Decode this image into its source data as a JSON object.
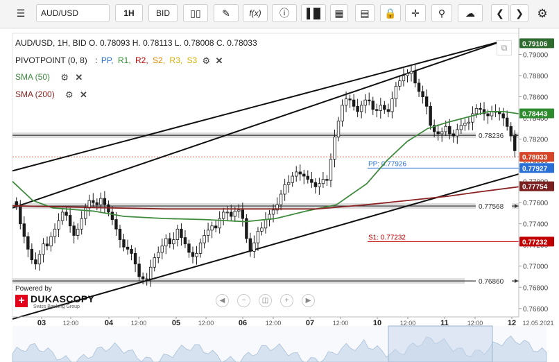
{
  "toolbar": {
    "menu_icon": "hamburger-icon",
    "symbol": "AUD/USD",
    "interval": "1H",
    "side": "BID",
    "icons": [
      "candles-icon",
      "pencil-icon",
      "function-icon",
      "info-icon",
      "bar-chart-icon",
      "calendar-icon",
      "notes-icon",
      "lock-icon",
      "crosshair-icon",
      "zoom-icon",
      "cloud-upload-icon",
      "chevron-left-icon",
      "chevron-right-icon",
      "gear-icon"
    ],
    "fx_label": "f(x)"
  },
  "legend": {
    "ohlc": "AUD/USD, 1H, BID   O. 0.78093 H. 0.78113 L. 0.78008 C. 0.78033",
    "pivot_label": "PIVOTPOINT (0, 8)",
    "pivot_sep": ":",
    "pivot_items": [
      {
        "text": "PP,",
        "color": "#2a6fd6"
      },
      {
        "text": "R1,",
        "color": "#2e8b2e"
      },
      {
        "text": "R2,",
        "color": "#c00000"
      },
      {
        "text": "S2,",
        "color": "#e08a00"
      },
      {
        "text": "R3,",
        "color": "#d4b000"
      },
      {
        "text": "S3",
        "color": "#d4b000"
      }
    ],
    "sma50": "SMA (50)",
    "sma200": "SMA (200)"
  },
  "branding": {
    "powered": "Powered by",
    "name": "DUKASCOPY",
    "tagline": "Swiss Banking Group"
  },
  "chart_data": {
    "type": "candlestick",
    "symbol": "AUD/USD",
    "timeframe": "1H",
    "y_ticks": [
      "0.79000",
      "0.78800",
      "0.78600",
      "0.78400",
      "0.78200",
      "0.78000",
      "0.77800",
      "0.77600",
      "0.77400",
      "0.77200",
      "0.77000",
      "0.76800",
      "0.76600"
    ],
    "ylim": [
      0.7652,
      0.792
    ],
    "x_labels": [
      "03",
      "12:00",
      "04",
      "12:00",
      "05",
      "12:00",
      "06",
      "12:00",
      "07",
      "12:00",
      "10",
      "12:00",
      "11",
      "12:00",
      "12",
      "12.05.2021"
    ],
    "price_badges": [
      {
        "label": "0.79106",
        "value": 0.79106,
        "color": "#2e6b2e"
      },
      {
        "label": "0.78443",
        "value": 0.78443,
        "color": "#2e8b2e"
      },
      {
        "label": "0.78033",
        "value": 0.78033,
        "color": "#d64527"
      },
      {
        "label": "0.77927",
        "value": 0.77927,
        "color": "#2a6fd6"
      },
      {
        "label": "0.77754",
        "value": 0.77754,
        "color": "#7a1f1f"
      },
      {
        "label": "0.77232",
        "value": 0.77232,
        "color": "#c00000"
      }
    ],
    "levels": [
      {
        "label": "0.78236",
        "value": 0.78236
      },
      {
        "label": "0.77568",
        "value": 0.77568
      },
      {
        "label": "0.76860",
        "value": 0.7686
      }
    ],
    "pivot_lines": [
      {
        "label": "PP: 0.77926",
        "value": 0.77926,
        "color": "#2a6fd6"
      },
      {
        "label": "S1: 0.77232",
        "value": 0.77232,
        "color": "#c00000"
      }
    ],
    "close": 0.78033,
    "series": [
      {
        "name": "AUD/USD",
        "close": [
          0.7757,
          0.774,
          0.7728,
          0.7716,
          0.7706,
          0.7702,
          0.7711,
          0.7721,
          0.7719,
          0.7728,
          0.7735,
          0.7743,
          0.7751,
          0.7748,
          0.7738,
          0.7729,
          0.7735,
          0.7745,
          0.7755,
          0.7762,
          0.776,
          0.7758,
          0.7764,
          0.7758,
          0.7751,
          0.7744,
          0.7735,
          0.7725,
          0.7718,
          0.7716,
          0.7712,
          0.7702,
          0.769,
          0.7688,
          0.7688,
          0.7699,
          0.7708,
          0.7713,
          0.7719,
          0.7726,
          0.7721,
          0.7725,
          0.7735,
          0.7727,
          0.7721,
          0.7713,
          0.7709,
          0.7712,
          0.7722,
          0.7729,
          0.7734,
          0.7738,
          0.7736,
          0.7745,
          0.7751,
          0.7751,
          0.7747,
          0.7752,
          0.7753,
          0.7745,
          0.7726,
          0.7714,
          0.7722,
          0.7733,
          0.7736,
          0.7744,
          0.7749,
          0.7753,
          0.7758,
          0.7768,
          0.7777,
          0.7779,
          0.7785,
          0.7789,
          0.7787,
          0.7785,
          0.7782,
          0.7779,
          0.7775,
          0.7778,
          0.7782,
          0.7781,
          0.7801,
          0.7822,
          0.7837,
          0.7852,
          0.7858,
          0.7857,
          0.7851,
          0.7846,
          0.7852,
          0.7857,
          0.7856,
          0.7848,
          0.7847,
          0.7852,
          0.7848,
          0.7846,
          0.7858,
          0.787,
          0.7875,
          0.788,
          0.7882,
          0.7884,
          0.7873,
          0.7865,
          0.786,
          0.7851,
          0.7833,
          0.7827,
          0.7825,
          0.7827,
          0.7832,
          0.7825,
          0.7823,
          0.7829,
          0.7833,
          0.7835,
          0.7836,
          0.7844,
          0.7849,
          0.7848,
          0.7844,
          0.7842,
          0.7846,
          0.7846,
          0.7844,
          0.784,
          0.7832,
          0.7823,
          0.7809
        ]
      },
      {
        "name": "SMA (50)",
        "values": [
          [
            0.0,
            0.778
          ],
          [
            0.04,
            0.7762
          ],
          [
            0.08,
            0.7755
          ],
          [
            0.16,
            0.7752
          ],
          [
            0.22,
            0.7747
          ],
          [
            0.3,
            0.7745
          ],
          [
            0.38,
            0.7744
          ],
          [
            0.46,
            0.7742
          ],
          [
            0.52,
            0.7745
          ],
          [
            0.58,
            0.7752
          ],
          [
            0.64,
            0.7758
          ],
          [
            0.7,
            0.7778
          ],
          [
            0.74,
            0.78
          ],
          [
            0.78,
            0.7818
          ],
          [
            0.82,
            0.783
          ],
          [
            0.86,
            0.7836
          ],
          [
            0.9,
            0.7841
          ],
          [
            0.94,
            0.7846
          ],
          [
            0.97,
            0.7846
          ],
          [
            1.0,
            0.7844
          ]
        ]
      },
      {
        "name": "SMA (200)",
        "values": [
          [
            0.0,
            0.7757
          ],
          [
            0.1,
            0.7756
          ],
          [
            0.2,
            0.7755
          ],
          [
            0.3,
            0.7754
          ],
          [
            0.45,
            0.7754
          ],
          [
            0.6,
            0.7754
          ],
          [
            0.7,
            0.7758
          ],
          [
            0.78,
            0.7762
          ],
          [
            0.86,
            0.7766
          ],
          [
            0.92,
            0.777
          ],
          [
            1.0,
            0.7775
          ]
        ]
      }
    ],
    "trendlines": [
      {
        "from": [
          0.0,
          0.779
        ],
        "to": [
          0.97,
          0.7913
        ]
      },
      {
        "from": [
          0.0,
          0.765
        ],
        "to": [
          1.0,
          0.7787
        ]
      },
      {
        "from": [
          0.0,
          0.7755
        ],
        "to": [
          0.97,
          0.7913
        ]
      }
    ]
  }
}
